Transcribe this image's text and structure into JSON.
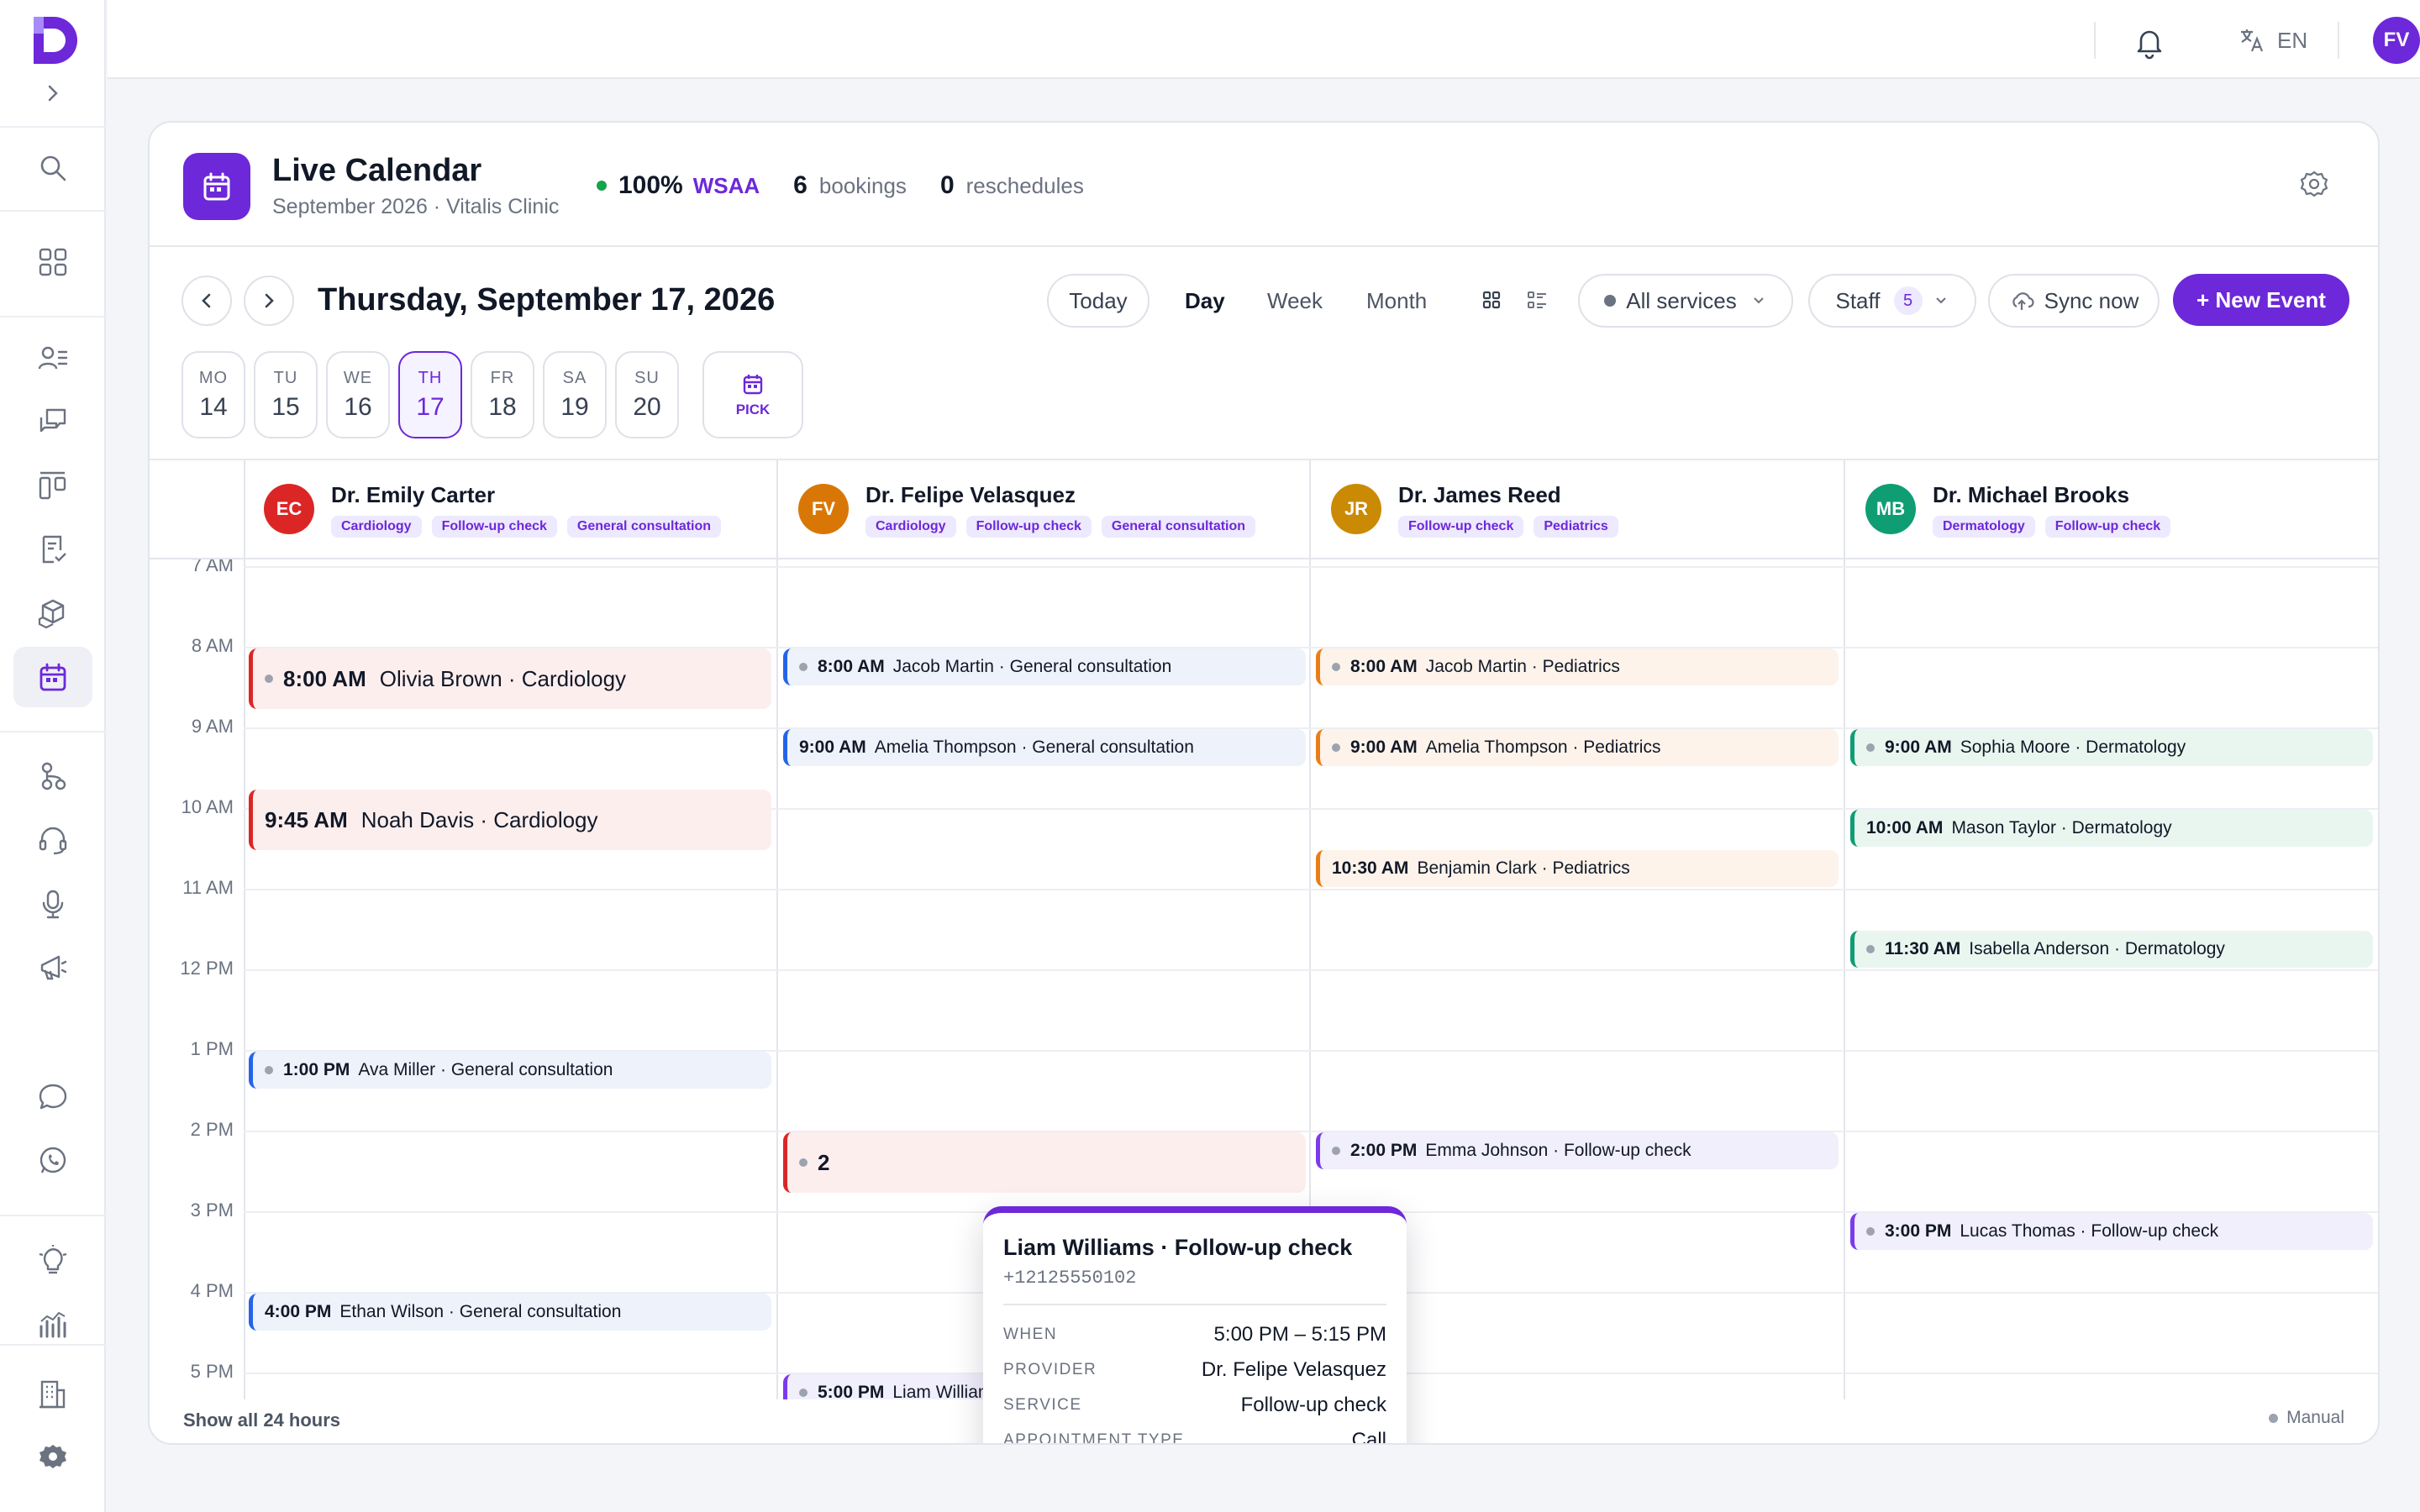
{
  "topbar": {
    "lang": "EN",
    "avatar_initials": "FV"
  },
  "header": {
    "title": "Live Calendar",
    "subtitle": "September 2026 · Vitalis Clinic",
    "wsaa_value": "100%",
    "wsaa_label": "WSAA",
    "bookings_value": "6",
    "bookings_label": "bookings",
    "reschedules_value": "0",
    "reschedules_label": "reschedules"
  },
  "toolbar": {
    "date_title": "Thursday, September 17, 2026",
    "today": "Today",
    "views": [
      "Day",
      "Week",
      "Month"
    ],
    "active_view": "Day",
    "services": "All services",
    "staff": "Staff",
    "staff_count": "5",
    "sync": "Sync now",
    "new_event": "+ New Event"
  },
  "days": [
    {
      "name": "MO",
      "num": "14"
    },
    {
      "name": "TU",
      "num": "15"
    },
    {
      "name": "WE",
      "num": "16"
    },
    {
      "name": "TH",
      "num": "17",
      "selected": true
    },
    {
      "name": "FR",
      "num": "18"
    },
    {
      "name": "SA",
      "num": "19"
    },
    {
      "name": "SU",
      "num": "20"
    }
  ],
  "pick_label": "PICK",
  "hours": [
    "7 AM",
    "8 AM",
    "9 AM",
    "10 AM",
    "11 AM",
    "12 PM",
    "1 PM",
    "2 PM",
    "3 PM",
    "4 PM",
    "5 PM"
  ],
  "resources": [
    {
      "initials": "EC",
      "name": "Dr. Emily Carter",
      "color": "#dc2626",
      "tags": [
        "Cardiology",
        "Follow-up check",
        "General consultation"
      ]
    },
    {
      "initials": "FV",
      "name": "Dr. Felipe Velasquez",
      "color": "#d97706",
      "tags": [
        "Cardiology",
        "Follow-up check",
        "General consultation"
      ]
    },
    {
      "initials": "JR",
      "name": "Dr. James Reed",
      "color": "#ca8a04",
      "tags": [
        "Follow-up check",
        "Pediatrics"
      ]
    },
    {
      "initials": "MB",
      "name": "Dr. Michael Brooks",
      "color": "#0f9d74",
      "tags": [
        "Dermatology",
        "Follow-up check"
      ]
    }
  ],
  "events": [
    {
      "col": 0,
      "time": "8:00 AM",
      "text": "Olivia Brown · Cardiology",
      "color": "red",
      "dot": true,
      "big": true,
      "start": 8.0
    },
    {
      "col": 0,
      "time": "9:45 AM",
      "text": "Noah Davis · Cardiology",
      "color": "red",
      "dot": false,
      "big": true,
      "start": 9.75
    },
    {
      "col": 0,
      "time": "1:00 PM",
      "text": "Ava Miller · General consultation",
      "color": "blue",
      "dot": true,
      "start": 13.0
    },
    {
      "col": 0,
      "time": "4:00 PM",
      "text": "Ethan Wilson · General consultation",
      "color": "blue",
      "dot": false,
      "start": 16.0
    },
    {
      "col": 1,
      "time": "8:00 AM",
      "text": "Jacob Martin · General consultation",
      "color": "blue",
      "dot": true,
      "start": 8.0
    },
    {
      "col": 1,
      "time": "9:00 AM",
      "text": "Amelia Thompson · General consultation",
      "color": "blue",
      "dot": false,
      "start": 9.0
    },
    {
      "col": 1,
      "time": "2",
      "text": "",
      "color": "red",
      "dot": true,
      "big": true,
      "start": 14.0
    },
    {
      "col": 1,
      "time": "5:00 PM",
      "text": "Liam Williams · Follow-up check",
      "color": "purple",
      "dot": true,
      "start": 17.0
    },
    {
      "col": 2,
      "time": "8:00 AM",
      "text": "Jacob Martin · Pediatrics",
      "color": "orange",
      "dot": true,
      "start": 8.0
    },
    {
      "col": 2,
      "time": "9:00 AM",
      "text": "Amelia Thompson · Pediatrics",
      "color": "orange",
      "dot": true,
      "start": 9.0
    },
    {
      "col": 2,
      "time": "10:30 AM",
      "text": "Benjamin Clark · Pediatrics",
      "color": "orange",
      "dot": false,
      "start": 10.5
    },
    {
      "col": 2,
      "time": "2:00 PM",
      "text": "Emma Johnson · Follow-up check",
      "color": "purple",
      "dot": true,
      "start": 14.0
    },
    {
      "col": 3,
      "time": "9:00 AM",
      "text": "Sophia Moore · Dermatology",
      "color": "green",
      "dot": true,
      "start": 9.0
    },
    {
      "col": 3,
      "time": "10:00 AM",
      "text": "Mason Taylor · Dermatology",
      "color": "green",
      "dot": false,
      "start": 10.0
    },
    {
      "col": 3,
      "time": "11:30 AM",
      "text": "Isabella Anderson · Dermatology",
      "color": "green",
      "dot": true,
      "start": 11.5
    },
    {
      "col": 3,
      "time": "3:00 PM",
      "text": "Lucas Thomas · Follow-up check",
      "color": "purple",
      "dot": true,
      "start": 15.0
    }
  ],
  "popover": {
    "title": "Liam Williams · Follow-up check",
    "phone": "+12125550102",
    "when_label": "WHEN",
    "when": "5:00 PM – 5:15 PM",
    "provider_label": "PROVIDER",
    "provider": "Dr. Felipe Velasquez",
    "service_label": "SERVICE",
    "service": "Follow-up check",
    "type_label": "APPOINTMENT TYPE",
    "type": "Call"
  },
  "footer": {
    "show_all": "Show all 24 hours",
    "mode": "Manual"
  }
}
